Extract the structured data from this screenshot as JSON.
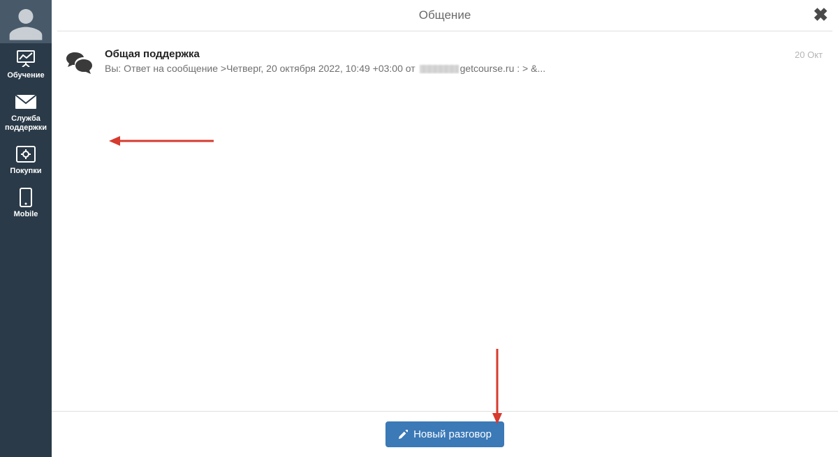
{
  "sidebar": {
    "items": [
      {
        "label1": "Обучение"
      },
      {
        "label1": "Служба",
        "label2": "поддержки"
      },
      {
        "label1": "Покупки"
      },
      {
        "label1": "Mobile"
      }
    ]
  },
  "header": {
    "title": "Общение"
  },
  "conversations": [
    {
      "title": "Общая поддержка",
      "preview_prefix": "Вы: Ответ на сообщение   >Четверг, 20 октября 2022, 10:49 +03:00 от ",
      "preview_suffix": "getcourse.ru : >  &...",
      "date": "20 Окт"
    }
  ],
  "footer": {
    "new_conversation_label": "Новый разговор"
  },
  "colors": {
    "sidebar_bg": "#2a3a48",
    "primary_button": "#3b79b7",
    "annotation": "#d73a2e"
  }
}
